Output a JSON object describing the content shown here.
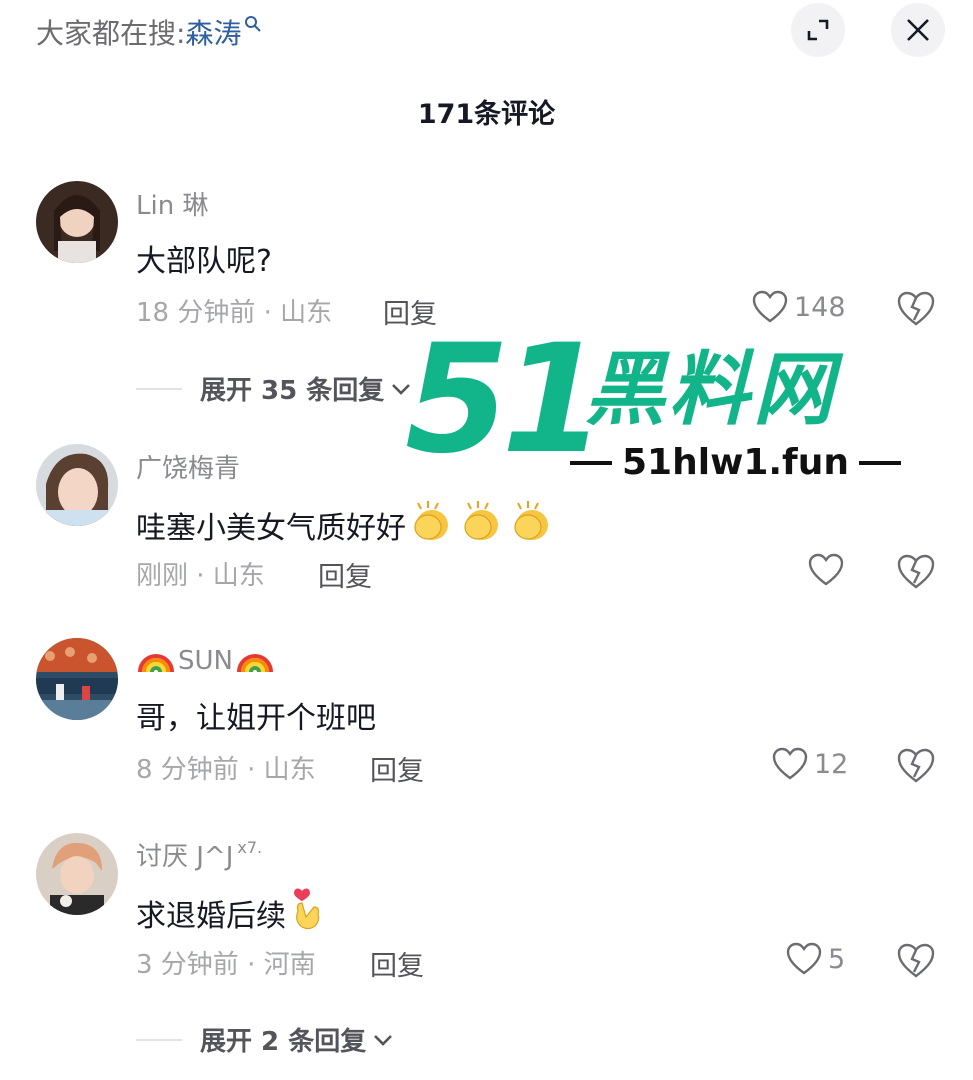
{
  "header": {
    "search_prefix": "大家都在搜:",
    "search_term": "森涛",
    "title": "171条评论"
  },
  "reply_label": "回复",
  "comments": [
    {
      "user": "Lin 琳",
      "text": "大部队呢?",
      "meta": "18 分钟前 · 山东",
      "likes": "148",
      "expand": "展开 35 条回复"
    },
    {
      "user": "广饶梅青",
      "text": "哇塞小美女气质好好",
      "meta": "刚刚 · 山东",
      "likes": "",
      "emoji": "clapping-hands x3"
    },
    {
      "user": "SUN",
      "text": "哥，让姐开个班吧",
      "meta": "8 分钟前 · 山东",
      "likes": "12",
      "emoji": "rainbow"
    },
    {
      "user": "讨厌 J^J",
      "user_suffix": "x7.",
      "text": "求退婚后续",
      "meta": "3 分钟前 · 河南",
      "likes": "5",
      "expand": "展开 2 条回复",
      "emoji": "finger-heart"
    }
  ],
  "watermark": {
    "number": "51",
    "name": "黑料网",
    "url": "51hlw1.fun",
    "color": "#12b48a"
  },
  "icons": [
    "search-icon",
    "expand-icon",
    "close-icon",
    "heart-icon",
    "broken-heart-icon",
    "chevron-down-icon"
  ]
}
